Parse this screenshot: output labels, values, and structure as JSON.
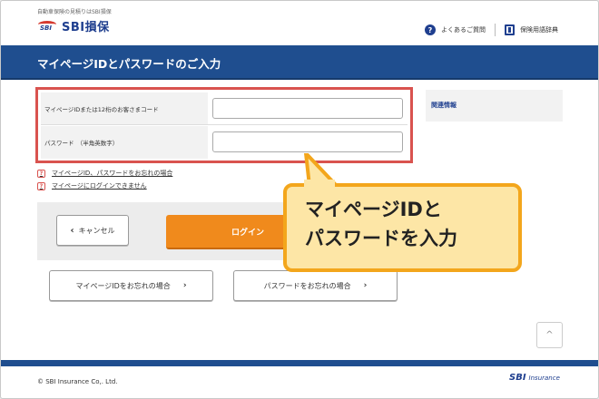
{
  "header": {
    "tagline": "自動車保険の見積りはSBI損保",
    "logo_text": "SBI損保",
    "logo_mark_text": "SBI",
    "faq_label": "よくあるご質問",
    "glossary_label": "保険用語辞典"
  },
  "page": {
    "title": "マイページIDとパスワードのご入力"
  },
  "form": {
    "id_label": "マイページIDまたは12桁のお客さまコード",
    "id_value": "",
    "password_label": "パスワード　（半角英数字）",
    "password_value": ""
  },
  "sidebar": {
    "title": "関連情報"
  },
  "help_links": [
    {
      "icon": "?",
      "label": "マイページID、パスワードをお忘れの場合"
    },
    {
      "icon": "?",
      "label": "マイページにログインできません"
    }
  ],
  "actions": {
    "cancel_label": "キャンセル",
    "cancel_chevron": "‹",
    "login_label": "ログイン"
  },
  "forgot_buttons": [
    {
      "label": "マイページIDをお忘れの場合",
      "chevron": "›"
    },
    {
      "label": "パスワードをお忘れの場合",
      "chevron": "›"
    }
  ],
  "callout": {
    "line1": "マイページIDと",
    "line2": "パスワードを入力"
  },
  "page_top": {
    "glyph": "^"
  },
  "footer": {
    "copyright": "© SBI Insurance Co,. Ltd.",
    "logo_sbi": "SBI",
    "logo_insurance": "Insurance"
  },
  "colors": {
    "brand_blue": "#1f4e8f",
    "accent_orange": "#f08a1c",
    "highlight_red": "#d9534f",
    "callout_fill": "#fde6a6",
    "callout_border": "#f3a61c"
  }
}
